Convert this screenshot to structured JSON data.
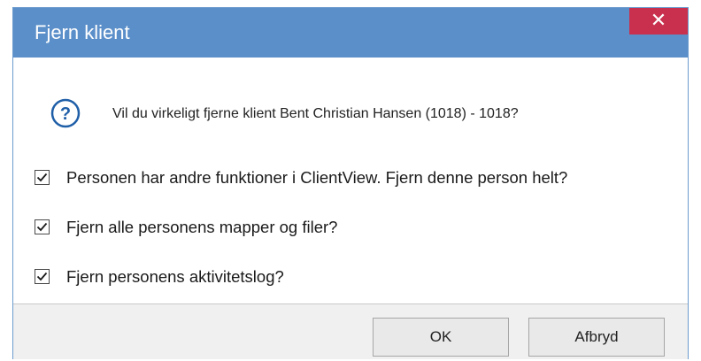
{
  "dialog": {
    "title": "Fjern klient",
    "close_label": "✕",
    "question_icon": "question-circle-icon",
    "message": "Vil du virkeligt fjerne klient Bent Christian Hansen (1018) - 1018?",
    "options": [
      {
        "label": "Personen har andre funktioner i ClientView. Fjern denne person helt?",
        "checked": true
      },
      {
        "label": "Fjern alle personens mapper og filer?",
        "checked": true
      },
      {
        "label": "Fjern personens aktivitetslog?",
        "checked": true
      }
    ],
    "buttons": {
      "ok_label": "OK",
      "cancel_label": "Afbryd"
    }
  },
  "colors": {
    "titlebar": "#5b8fc9",
    "close_button": "#c8304e",
    "icon_accent": "#1f5fa8"
  }
}
